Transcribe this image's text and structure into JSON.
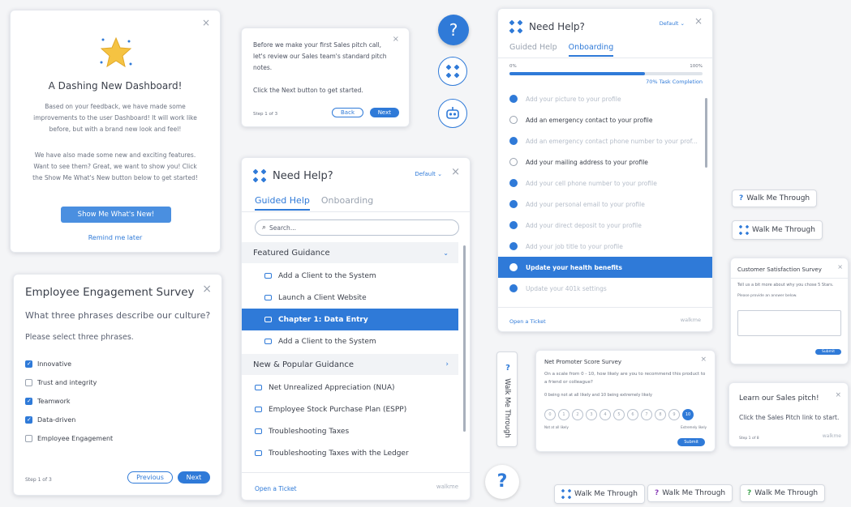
{
  "colors": {
    "accent": "#2f7ad8",
    "star": "#f5c342"
  },
  "dashboard": {
    "title": "A Dashing New Dashboard!",
    "body1": "Based on your feedback, we have made some improvements to the user Dashboard! It will work like before, but with a brand new look and feel!",
    "body2": "We have also made some new and exciting features. Want to see them? Great, we want to show you! Click the Show Me What's New button below to get started!",
    "primary": "Show Me What's New!",
    "secondary": "Remind me later",
    "close": "×"
  },
  "pitch_tip": {
    "body1": "Before we make your first Sales pitch call, let's review our Sales team's standard pitch notes.",
    "body2": "Click the Next button to get started.",
    "step": "Step 1 of 3",
    "back": "Back",
    "next": "Next",
    "close": "×"
  },
  "survey": {
    "title": "Employee Engagement Survey",
    "question": "What three phrases describe our culture?",
    "instruction": "Please select three phrases.",
    "options": [
      {
        "label": "Innovative",
        "checked": true
      },
      {
        "label": "Trust and integrity",
        "checked": false
      },
      {
        "label": "Teamwork",
        "checked": true
      },
      {
        "label": "Data-driven",
        "checked": true
      },
      {
        "label": "Employee Engagement",
        "checked": false
      }
    ],
    "step": "Step 1 of 3",
    "previous": "Previous",
    "next": "Next",
    "close": "×"
  },
  "help_center": {
    "title": "Need Help?",
    "default": "Default ⌄",
    "close": "×",
    "tabs": [
      "Guided Help",
      "Onboarding"
    ],
    "search_placeholder": "Search...",
    "featured": "Featured Guidance",
    "featured_items": [
      "Add a Client to the System",
      "Launch a Client Website",
      "Chapter 1: Data Entry",
      "Add a Client to the System"
    ],
    "popular": "New & Popular Guidance",
    "popular_items": [
      "Net Unrealized Appreciation (NUA)",
      "Employee Stock Purchase Plan (ESPP)",
      "Troubleshooting Taxes",
      "Troubleshooting Taxes with the Ledger"
    ],
    "ticket": "Open a Ticket",
    "brand": "walkme"
  },
  "onboarding": {
    "title": "Need Help?",
    "default": "Default ⌄",
    "close": "×",
    "tabs": [
      "Guided Help",
      "Onboarding"
    ],
    "min": "0%",
    "max": "100%",
    "progress": 0.7,
    "progress_label": "70% Task Completion",
    "tasks": [
      {
        "label": "Add your picture to your profile",
        "done": true
      },
      {
        "label": "Add an emergency contact to your profile",
        "done": false
      },
      {
        "label": "Add an emergency contact phone number to your prof...",
        "done": true
      },
      {
        "label": "Add your mailing address to your profile",
        "done": false
      },
      {
        "label": "Add your cell phone number to your profile",
        "done": true
      },
      {
        "label": "Add your personal email to your profile",
        "done": true
      },
      {
        "label": "Add your direct deposit to your profile",
        "done": true
      },
      {
        "label": "Add your job title to your profile",
        "done": true
      },
      {
        "label": "Update your health benefits",
        "done": false,
        "active": true
      },
      {
        "label": "Update your 401k settings",
        "done": true
      }
    ],
    "ticket": "Open a Ticket",
    "brand": "walkme"
  },
  "launchers": {
    "walk": "Walk Me Through",
    "q": "?"
  },
  "nps": {
    "title": "Net Promoter Score Survey",
    "question": "On a scale from 0 - 10, how likely are you to recommend this product to a friend or colleague?",
    "hint": "0 being not at all likely and 10 being extremely likely",
    "scale": [
      "0",
      "1",
      "2",
      "3",
      "4",
      "5",
      "6",
      "7",
      "8",
      "9",
      "10"
    ],
    "low": "Not at all likely",
    "high": "Extremely likely",
    "submit": "Submit",
    "close": "×"
  },
  "csat": {
    "title": "Customer Satisfaction Survey",
    "question": "Tell us a bit more about why you chose 5 Stars.",
    "prompt": "Please provide an answer below.",
    "submit": "Submit",
    "close": "×"
  },
  "sales": {
    "title": "Learn our Sales pitch!",
    "body": "Click the Sales Pitch link to start.",
    "step": "Step 1 of 8",
    "brand": "walkme",
    "close": "×"
  }
}
